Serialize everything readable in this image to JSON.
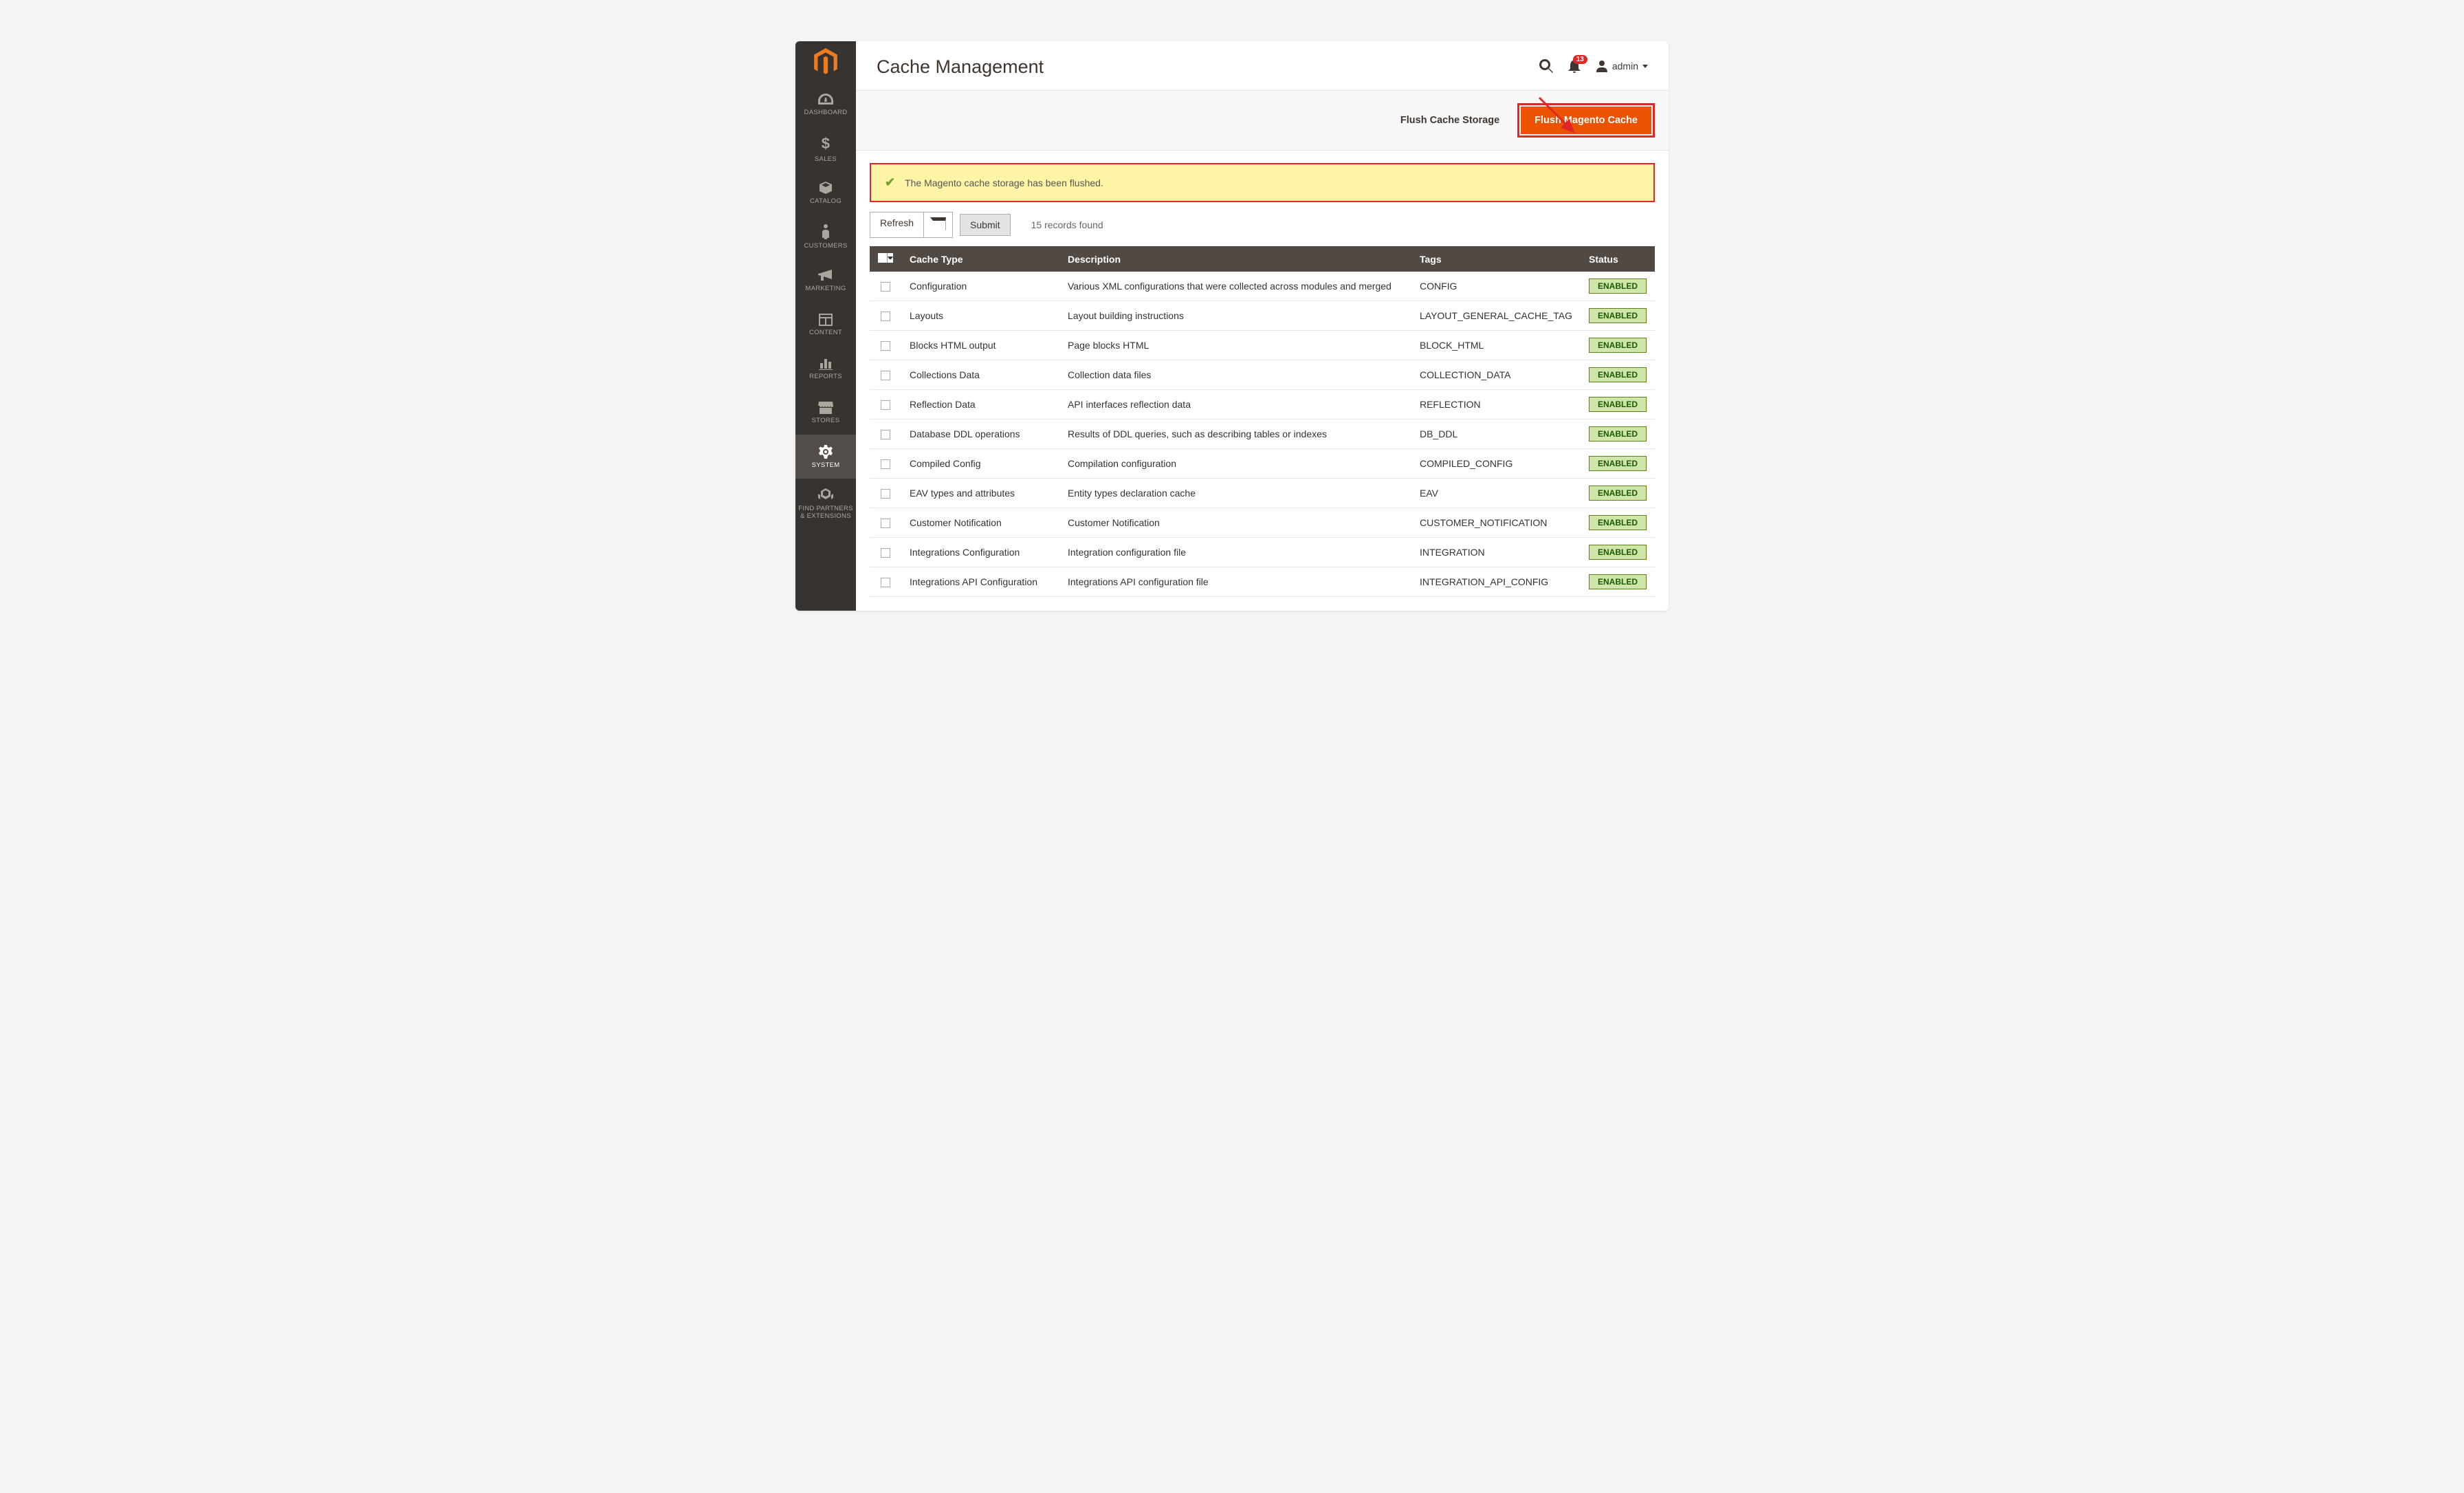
{
  "sidebar": {
    "items": [
      {
        "label": "DASHBOARD"
      },
      {
        "label": "SALES"
      },
      {
        "label": "CATALOG"
      },
      {
        "label": "CUSTOMERS"
      },
      {
        "label": "MARKETING"
      },
      {
        "label": "CONTENT"
      },
      {
        "label": "REPORTS"
      },
      {
        "label": "STORES"
      },
      {
        "label": "SYSTEM"
      },
      {
        "label": "FIND PARTNERS & EXTENSIONS"
      }
    ]
  },
  "header": {
    "title": "Cache Management",
    "notif_count": "13",
    "user": "admin"
  },
  "actions": {
    "flush_storage": "Flush Cache Storage",
    "flush_magento": "Flush Magento Cache"
  },
  "message": {
    "text": "The Magento cache storage has been flushed."
  },
  "toolbar": {
    "refresh": "Refresh",
    "submit": "Submit",
    "records": "15 records found"
  },
  "table": {
    "headers": {
      "type": "Cache Type",
      "desc": "Description",
      "tags": "Tags",
      "status": "Status"
    },
    "status_label": "ENABLED",
    "rows": [
      {
        "type": "Configuration",
        "desc": "Various XML configurations that were collected across modules and merged",
        "tags": "CONFIG"
      },
      {
        "type": "Layouts",
        "desc": "Layout building instructions",
        "tags": "LAYOUT_GENERAL_CACHE_TAG"
      },
      {
        "type": "Blocks HTML output",
        "desc": "Page blocks HTML",
        "tags": "BLOCK_HTML"
      },
      {
        "type": "Collections Data",
        "desc": "Collection data files",
        "tags": "COLLECTION_DATA"
      },
      {
        "type": "Reflection Data",
        "desc": "API interfaces reflection data",
        "tags": "REFLECTION"
      },
      {
        "type": "Database DDL operations",
        "desc": "Results of DDL queries, such as describing tables or indexes",
        "tags": "DB_DDL"
      },
      {
        "type": "Compiled Config",
        "desc": "Compilation configuration",
        "tags": "COMPILED_CONFIG"
      },
      {
        "type": "EAV types and attributes",
        "desc": "Entity types declaration cache",
        "tags": "EAV"
      },
      {
        "type": "Customer Notification",
        "desc": "Customer Notification",
        "tags": "CUSTOMER_NOTIFICATION"
      },
      {
        "type": "Integrations Configuration",
        "desc": "Integration configuration file",
        "tags": "INTEGRATION"
      },
      {
        "type": "Integrations API Configuration",
        "desc": "Integrations API configuration file",
        "tags": "INTEGRATION_API_CONFIG"
      }
    ]
  }
}
